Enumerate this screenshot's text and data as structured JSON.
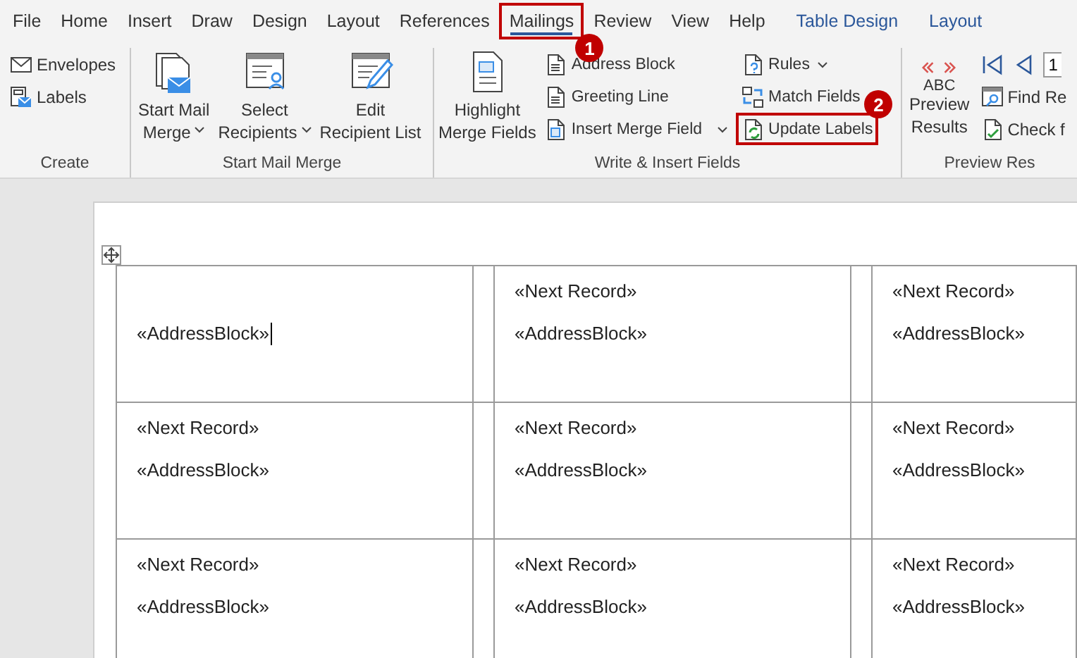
{
  "tabs": [
    {
      "label": "File",
      "kind": "normal",
      "selected": false
    },
    {
      "label": "Home",
      "kind": "normal",
      "selected": false
    },
    {
      "label": "Insert",
      "kind": "normal",
      "selected": false
    },
    {
      "label": "Draw",
      "kind": "normal",
      "selected": false
    },
    {
      "label": "Design",
      "kind": "normal",
      "selected": false
    },
    {
      "label": "Layout",
      "kind": "normal",
      "selected": false
    },
    {
      "label": "References",
      "kind": "normal",
      "selected": false
    },
    {
      "label": "Mailings",
      "kind": "normal",
      "selected": true,
      "badge": "1"
    },
    {
      "label": "Review",
      "kind": "normal",
      "selected": false
    },
    {
      "label": "View",
      "kind": "normal",
      "selected": false
    },
    {
      "label": "Help",
      "kind": "normal",
      "selected": false
    },
    {
      "label": "Table Design",
      "kind": "contextual",
      "selected": false
    },
    {
      "label": "Layout",
      "kind": "contextual",
      "selected": false
    }
  ],
  "ribbon": {
    "groups": [
      {
        "label": "Create",
        "items": [
          {
            "kind": "small",
            "label": "Envelopes",
            "dropdown": false
          },
          {
            "kind": "small",
            "label": "Labels",
            "dropdown": false
          }
        ]
      },
      {
        "label": "Start Mail Merge",
        "items": [
          {
            "kind": "large",
            "label": [
              "Start Mail",
              "Merge"
            ],
            "dropdown": true
          },
          {
            "kind": "large",
            "label": [
              "Select",
              "Recipients"
            ],
            "dropdown": true
          },
          {
            "kind": "large",
            "label": [
              "Edit",
              "Recipient List"
            ],
            "dropdown": false
          }
        ]
      },
      {
        "label": "Write & Insert Fields",
        "items": [
          {
            "kind": "large",
            "label": [
              "Highlight",
              "Merge Fields"
            ],
            "dropdown": false
          },
          {
            "kind": "small",
            "label": "Address Block",
            "dropdown": false
          },
          {
            "kind": "small",
            "label": "Greeting Line",
            "dropdown": false
          },
          {
            "kind": "small",
            "label": "Insert Merge Field",
            "dropdown": true
          },
          {
            "kind": "small",
            "label": "Rules",
            "dropdown": true
          },
          {
            "kind": "small",
            "label": "Match Fields",
            "dropdown": false
          },
          {
            "kind": "small",
            "label": "Update Labels",
            "dropdown": false,
            "badge": "2"
          }
        ]
      },
      {
        "label": "Preview Res",
        "items": [
          {
            "kind": "large",
            "label": [
              "Preview",
              "Results"
            ],
            "icon_text": "ABC",
            "dropdown": false
          },
          {
            "kind": "nav",
            "value": "1"
          },
          {
            "kind": "small",
            "label": "Find Re",
            "dropdown": false
          },
          {
            "kind": "small",
            "label": "Check f",
            "dropdown": false
          }
        ]
      }
    ]
  },
  "table": {
    "rows": [
      {
        "cells": [
          {
            "lines": [
              {
                "kind": "address",
                "text": "«AddressBlock»"
              }
            ],
            "cursor": true
          },
          {
            "lines": [
              {
                "kind": "next",
                "text": "«Next Record»"
              },
              {
                "kind": "address",
                "text": "«AddressBlock»"
              }
            ],
            "cursor": false
          },
          {
            "lines": [
              {
                "kind": "next",
                "text": "«Next Record»"
              },
              {
                "kind": "address",
                "text": "«AddressBlock»"
              }
            ],
            "cursor": false
          }
        ]
      },
      {
        "cells": [
          {
            "lines": [
              {
                "kind": "next",
                "text": "«Next Record»"
              },
              {
                "kind": "address",
                "text": "«AddressBlock»"
              }
            ],
            "cursor": false
          },
          {
            "lines": [
              {
                "kind": "next",
                "text": "«Next Record»"
              },
              {
                "kind": "address",
                "text": "«AddressBlock»"
              }
            ],
            "cursor": false
          },
          {
            "lines": [
              {
                "kind": "next",
                "text": "«Next Record»"
              },
              {
                "kind": "address",
                "text": "«AddressBlock»"
              }
            ],
            "cursor": false
          }
        ]
      },
      {
        "cells": [
          {
            "lines": [
              {
                "kind": "next",
                "text": "«Next Record»"
              },
              {
                "kind": "address",
                "text": "«AddressBlock»"
              }
            ],
            "cursor": false
          },
          {
            "lines": [
              {
                "kind": "next",
                "text": "«Next Record»"
              },
              {
                "kind": "address",
                "text": "«AddressBlock»"
              }
            ],
            "cursor": false
          },
          {
            "lines": [
              {
                "kind": "next",
                "text": "«Next Record»"
              },
              {
                "kind": "address",
                "text": "«AddressBlock»"
              }
            ],
            "cursor": false
          }
        ]
      }
    ]
  }
}
